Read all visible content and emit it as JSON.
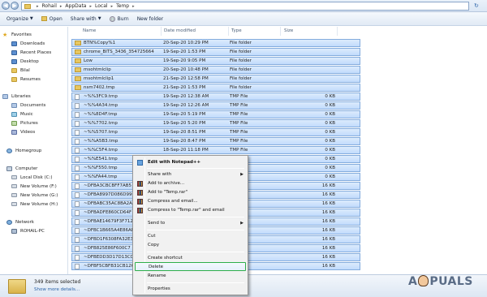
{
  "address": {
    "crumbs": [
      "Rohail",
      "AppData",
      "Local",
      "Temp"
    ]
  },
  "toolbar": {
    "organize": "Organize",
    "open": "Open",
    "share_with": "Share with",
    "burn": "Burn",
    "new_folder": "New folder"
  },
  "nav": {
    "favorites": "Favorites",
    "downloads": "Downloads",
    "recent_places": "Recent Places",
    "desktop": "Desktop",
    "bilal": "Bilal",
    "resumes": "Resumes",
    "libraries": "Libraries",
    "documents": "Documents",
    "music": "Music",
    "pictures": "Pictures",
    "videos": "Videos",
    "homegroup": "Homegroup",
    "computer": "Computer",
    "local_disk": "Local Disk (C:)",
    "vol_f": "New Volume (F:)",
    "vol_g": "New Volume (G:)",
    "vol_h": "New Volume (H:)",
    "network": "Network",
    "rohail_pc": "ROHAIL-PC"
  },
  "columns": {
    "name": "Name",
    "date": "Date modified",
    "type": "Type",
    "size": "Size"
  },
  "files": [
    {
      "name": "BTN%Copy%1",
      "date": "20-Sep-20 10:29 PM",
      "type": "File folder",
      "size": ""
    },
    {
      "name": "chrome_BITS_3436_354725664",
      "date": "19-Sep-20 1:53 PM",
      "type": "File folder",
      "size": ""
    },
    {
      "name": "Low",
      "date": "19-Sep-20 9:05 PM",
      "type": "File folder",
      "size": ""
    },
    {
      "name": "msohtmlclip",
      "date": "20-Sep-20 10:48 PM",
      "type": "File folder",
      "size": ""
    },
    {
      "name": "msohtmlclip1",
      "date": "21-Sep-20 12:58 PM",
      "type": "File folder",
      "size": ""
    },
    {
      "name": "nsm7402.tmp",
      "date": "21-Sep-20 1:53 PM",
      "type": "File folder",
      "size": ""
    },
    {
      "name": "~%%3FC9.tmp",
      "date": "19-Sep-20 12:38 AM",
      "type": "TMP File",
      "size": "0 KB"
    },
    {
      "name": "~%%4A34.tmp",
      "date": "19-Sep-20 12:26 AM",
      "type": "TMP File",
      "size": "0 KB"
    },
    {
      "name": "~%%8D4F.tmp",
      "date": "19-Sep-20 5:19 PM",
      "type": "TMP File",
      "size": "0 KB"
    },
    {
      "name": "~%%7702.tmp",
      "date": "19-Sep-20 5:20 PM",
      "type": "TMP File",
      "size": "0 KB"
    },
    {
      "name": "~%%5707.tmp",
      "date": "19-Sep-20 8:51 PM",
      "type": "TMP File",
      "size": "0 KB"
    },
    {
      "name": "~%%A5B3.tmp",
      "date": "19-Sep-20 8:47 PM",
      "type": "TMP File",
      "size": "0 KB"
    },
    {
      "name": "~%%C5F4.tmp",
      "date": "18-Sep-20 11:18 PM",
      "type": "TMP File",
      "size": "0 KB"
    },
    {
      "name": "~%%E541.tmp",
      "date": "",
      "type": "",
      "size": "0 KB"
    },
    {
      "name": "~%%F550.tmp",
      "date": "",
      "type": "",
      "size": "0 KB"
    },
    {
      "name": "~%%FA44.tmp",
      "date": "",
      "type": "",
      "size": "0 KB"
    },
    {
      "name": "~DFBA3CBCBFF7AB5",
      "date": "",
      "type": "",
      "size": "16 KB"
    },
    {
      "name": "~DFBA8997D086D99C",
      "date": "",
      "type": "",
      "size": "16 KB"
    },
    {
      "name": "~DFBABC35AC8BA2A",
      "date": "",
      "type": "",
      "size": "16 KB"
    },
    {
      "name": "~DFBADFE860CD64F",
      "date": "",
      "type": "",
      "size": "16 KB"
    },
    {
      "name": "~DFBAE14679F3F712",
      "date": "",
      "type": "",
      "size": "16 KB"
    },
    {
      "name": "~DFBC1B665A4E86AF",
      "date": "",
      "type": "",
      "size": "16 KB"
    },
    {
      "name": "~DFBD1F6308FA32E3",
      "date": "",
      "type": "",
      "size": "16 KB"
    },
    {
      "name": "~DFB825E86F600C7",
      "date": "",
      "type": "",
      "size": "16 KB"
    },
    {
      "name": "~DFBEDD3D17D13C0",
      "date": "",
      "type": "",
      "size": "16 KB"
    },
    {
      "name": "~DFBF5CBFB31CB1261",
      "date": "",
      "type": "",
      "size": "16 KB"
    }
  ],
  "context_menu": {
    "edit_notepad": "Edit with Notepad++",
    "share_with": "Share with",
    "add_archive": "Add to archive...",
    "add_temp_rar": "Add to \"Temp.rar\"",
    "compress_email": "Compress and email...",
    "compress_temp_email": "Compress to \"Temp.rar\" and email",
    "send_to": "Send to",
    "cut": "Cut",
    "copy": "Copy",
    "create_shortcut": "Create shortcut",
    "delete": "Delete",
    "rename": "Rename",
    "properties": "Properties"
  },
  "details": {
    "count": "349 items selected",
    "show_more": "Show more details..."
  },
  "watermark": {
    "text_a": "A",
    "text_rest": "PUALS"
  },
  "colors": {
    "selection": "#c1dbfc",
    "delete_highlight": "#2eae4a"
  }
}
